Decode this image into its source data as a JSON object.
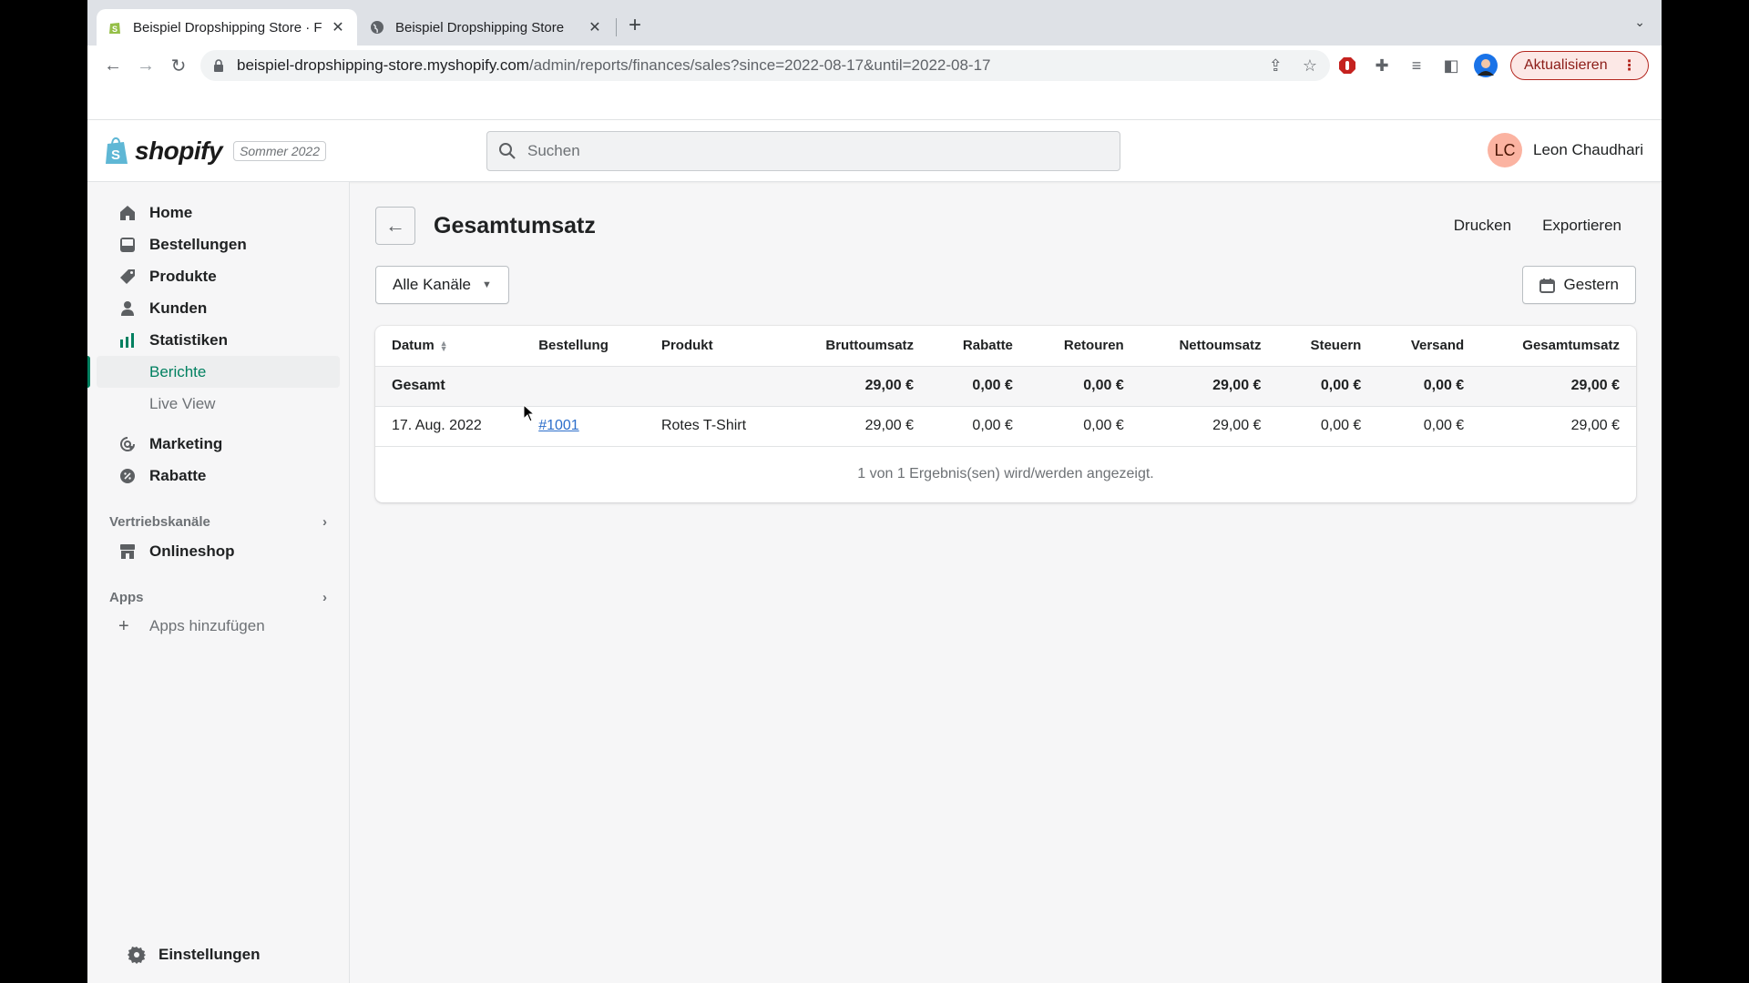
{
  "browser": {
    "tabs": [
      {
        "title": "Beispiel Dropshipping Store · F",
        "active": true,
        "favicon": "shopify-icon"
      },
      {
        "title": "Beispiel Dropshipping Store",
        "active": false,
        "favicon": "globe-icon"
      }
    ],
    "url_host": "beispiel-dropshipping-store.myshopify.com",
    "url_path": "/admin/reports/finances/sales?since=2022-08-17&until=2022-08-17",
    "update_label": "Aktualisieren"
  },
  "topbar": {
    "brand": "shopify",
    "edition": "Sommer 2022",
    "search_placeholder": "Suchen",
    "user_initials": "LC",
    "user_name": "Leon Chaudhari"
  },
  "sidebar": {
    "items": [
      {
        "label": "Home",
        "icon": "home-icon"
      },
      {
        "label": "Bestellungen",
        "icon": "orders-icon"
      },
      {
        "label": "Produkte",
        "icon": "tag-icon"
      },
      {
        "label": "Kunden",
        "icon": "person-icon"
      },
      {
        "label": "Statistiken",
        "icon": "analytics-icon"
      },
      {
        "label": "Berichte",
        "sub": true,
        "active": true
      },
      {
        "label": "Live View",
        "sub": true
      },
      {
        "label": "Marketing",
        "icon": "marketing-icon"
      },
      {
        "label": "Rabatte",
        "icon": "discount-icon"
      }
    ],
    "sales_channels_heading": "Vertriebskanäle",
    "online_store": "Onlineshop",
    "apps_heading": "Apps",
    "add_apps": "Apps hinzufügen",
    "settings": "Einstellungen"
  },
  "page": {
    "title": "Gesamtumsatz",
    "print": "Drucken",
    "export": "Exportieren",
    "channel_filter": "Alle Kanäle",
    "date_filter": "Gestern"
  },
  "table": {
    "columns": [
      "Datum",
      "Bestellung",
      "Produkt",
      "Bruttoumsatz",
      "Rabatte",
      "Retouren",
      "Nettoumsatz",
      "Steuern",
      "Versand",
      "Gesamtumsatz"
    ],
    "total": {
      "label": "Gesamt",
      "gross": "29,00 €",
      "discounts": "0,00 €",
      "returns": "0,00 €",
      "net": "29,00 €",
      "taxes": "0,00 €",
      "shipping": "0,00 €",
      "total": "29,00 €"
    },
    "rows": [
      {
        "date": "17. Aug. 2022",
        "order": "#1001",
        "product": "Rotes T-Shirt",
        "gross": "29,00 €",
        "discounts": "0,00 €",
        "returns": "0,00 €",
        "net": "29,00 €",
        "taxes": "0,00 €",
        "shipping": "0,00 €",
        "total": "29,00 €"
      }
    ],
    "footer": "1 von 1 Ergebnis(sen) wird/werden angezeigt."
  }
}
